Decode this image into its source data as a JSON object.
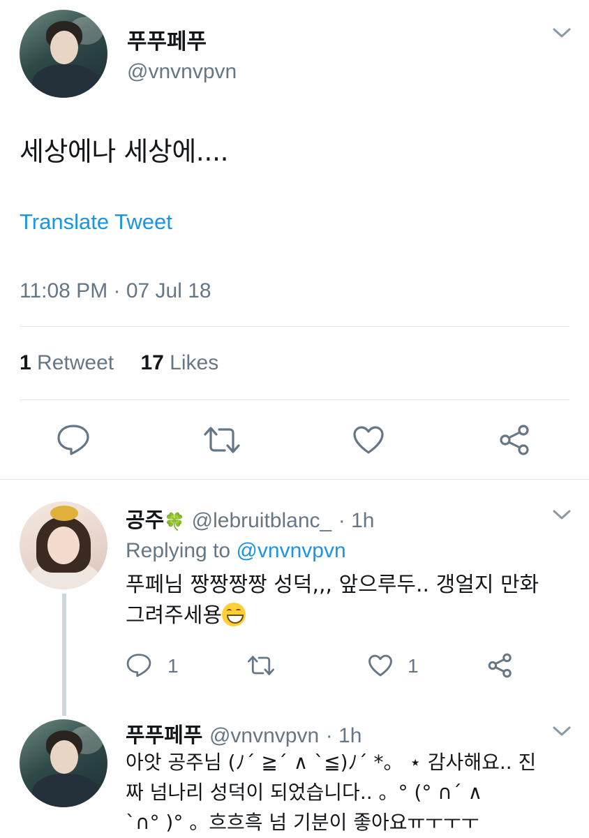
{
  "main_tweet": {
    "display_name": "푸푸페푸",
    "handle": "@vnvnvpvn",
    "text": "세상에나 세상에....",
    "translate_label": "Translate Tweet",
    "timestamp": "11:08 PM · 07 Jul 18",
    "retweet_count": "1",
    "retweet_label": "Retweet",
    "like_count": "17",
    "like_label": "Likes",
    "icons": [
      "chevron-down-icon",
      "reply-icon",
      "retweet-icon",
      "like-icon",
      "share-icon"
    ]
  },
  "replies": [
    {
      "display_name": "공주",
      "name_emoji": "🍀",
      "handle": "@lebruitblanc_",
      "time": "· 1h",
      "replying_prefix": "Replying to",
      "replying_to": "@vnvnvpvn",
      "text_line1": "푸페님 짱짱짱짱 성덕,,, 앞으루두.. 갱얼지 만화",
      "text_line2": "그려주세용",
      "reply_count": "1",
      "retweet_count": "",
      "like_count": "1"
    },
    {
      "display_name": "푸푸페푸",
      "handle": "@vnvnvpvn",
      "time": "· 1h",
      "text_line1": "아앗 공주님 (ﾉ´ ≧´ ∧ `≦)ﾉ´ *。 ⋆ 감사해요.. 진",
      "text_line2": "짜 넘나리 성덕이 되었습니다.. 。° (° ∩´ ∧",
      "text_line3": "`∩° )° 。흐흐흑 넘 기분이 좋아요ㅠㅜㅜㅜ"
    }
  ],
  "colors": {
    "link": "#1b95e0",
    "secondary_text": "#657786",
    "primary_text": "#14171a",
    "divider": "#e1e8ed"
  }
}
